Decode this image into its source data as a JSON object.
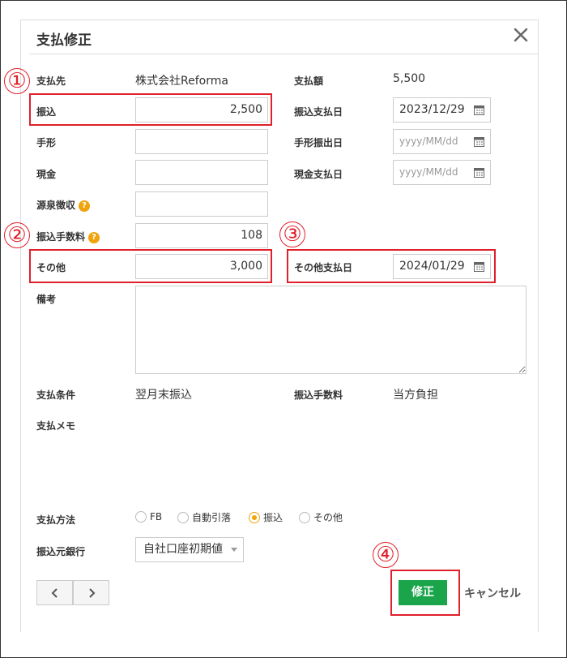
{
  "dialog": {
    "title": "支払修正"
  },
  "fields": {
    "payee_label": "支払先",
    "payee_value": "株式会社Reforma",
    "amount_label": "支払額",
    "amount_value": "5,500",
    "transfer_label": "振込",
    "transfer_value": "2,500",
    "transfer_date_label": "振込支払日",
    "transfer_date_value": "2023/12/29",
    "bill_label": "手形",
    "bill_value": "",
    "bill_date_label": "手形振出日",
    "bill_date_placeholder": "yyyy/MM/dd",
    "cash_label": "現金",
    "cash_value": "",
    "cash_date_label": "現金支払日",
    "cash_date_placeholder": "yyyy/MM/dd",
    "withholding_label": "源泉徴収",
    "withholding_value": "",
    "fee_label": "振込手数料",
    "fee_value": "108",
    "other_label": "その他",
    "other_value": "3,000",
    "other_date_label": "その他支払日",
    "other_date_value": "2024/01/29",
    "note_label": "備考",
    "note_value": "",
    "terms_label": "支払条件",
    "terms_value": "翌月末振込",
    "fee_burden_label": "振込手数料",
    "fee_burden_value": "当方負担",
    "memo_label": "支払メモ",
    "method_label": "支払方法",
    "methods": [
      "FB",
      "自動引落",
      "振込",
      "その他"
    ],
    "method_selected": "振込",
    "bank_label": "振込元銀行",
    "bank_value": "自社口座初期値"
  },
  "buttons": {
    "save": "修正",
    "cancel": "キャンセル"
  },
  "annotations": [
    "①",
    "②",
    "③",
    "④"
  ],
  "colors": {
    "accent_red": "#e0202a",
    "save_green": "#1aa54a",
    "help_orange": "#f0a30a"
  }
}
